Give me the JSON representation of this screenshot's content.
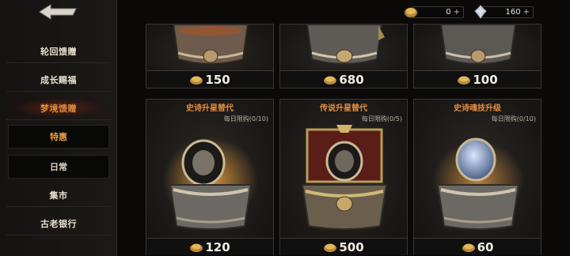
{
  "sidebar": {
    "items": [
      {
        "label": "轮回馈赠",
        "active": false
      },
      {
        "label": "成长赐福",
        "active": false
      },
      {
        "label": "梦境馈赠",
        "active": true
      },
      {
        "label": "集市",
        "active": false
      },
      {
        "label": "古老银行",
        "active": false
      }
    ],
    "sub_items": [
      {
        "label": "特惠",
        "selected": true
      },
      {
        "label": "日常",
        "selected": false
      }
    ]
  },
  "currency": {
    "gold": "0",
    "diamond": "160"
  },
  "top_row": [
    {
      "price": "150"
    },
    {
      "price": "680"
    },
    {
      "price": "100"
    }
  ],
  "cards": [
    {
      "title": "史诗升星替代",
      "limit": "每日限购(0/10)",
      "price": "120"
    },
    {
      "title": "传说升星替代",
      "limit": "每日限购(0/5)",
      "price": "500"
    },
    {
      "title": "史诗魂技升级",
      "limit": "每日限购(0/10)",
      "price": "60"
    }
  ],
  "colors": {
    "accent": "#e38e3e",
    "active_nav": "#e08a3c"
  }
}
